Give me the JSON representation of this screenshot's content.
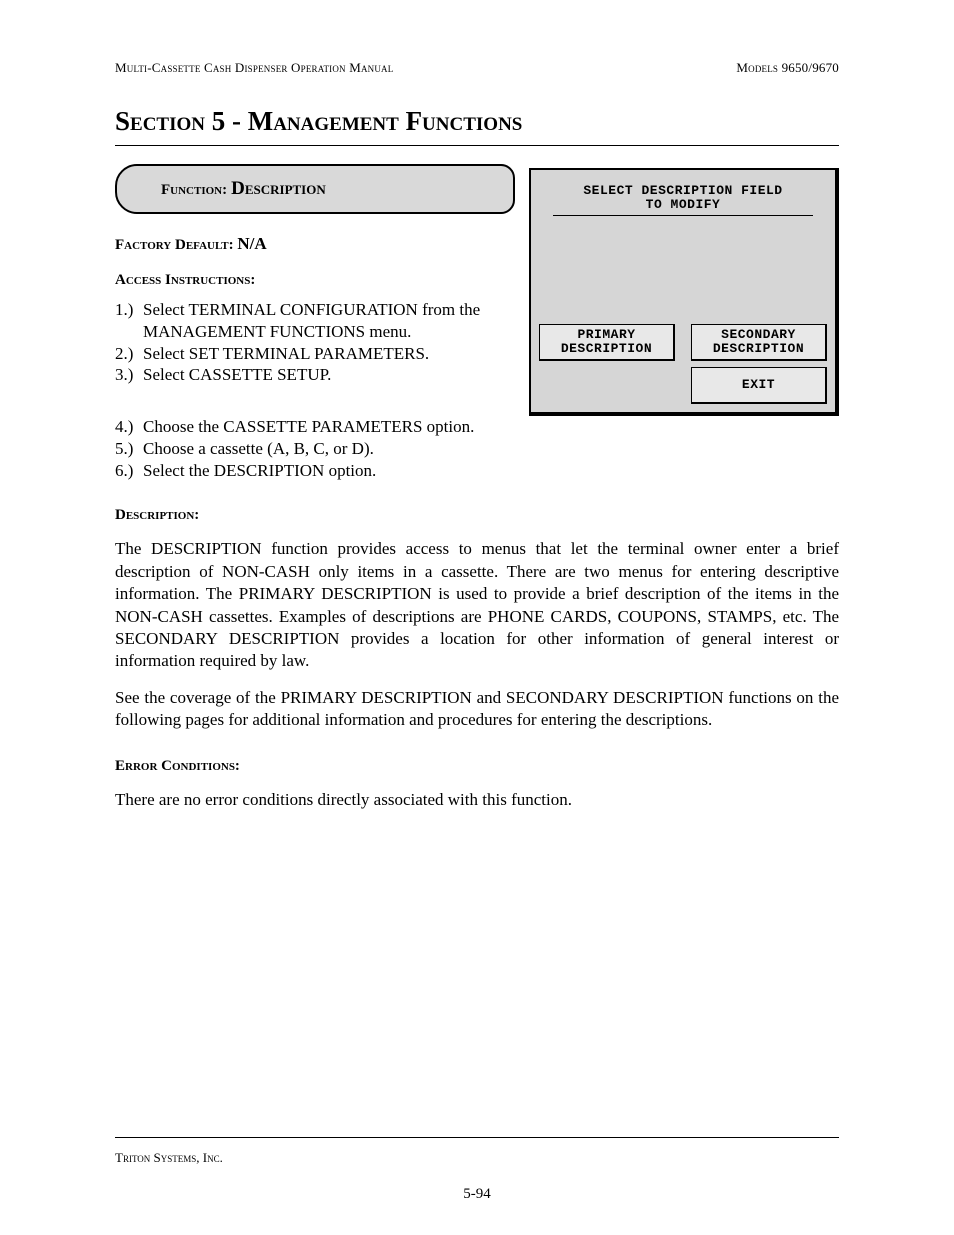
{
  "header": {
    "left": "Multi-Cassette Cash Dispenser Operation Manual",
    "right": "Models 9650/9670"
  },
  "section_title": "Section 5 - Management Functions",
  "function_box": {
    "label": "Function:",
    "value": "Description"
  },
  "factory_default": {
    "label": "Factory Default:",
    "value": "N/A"
  },
  "access_instructions": {
    "heading": "Access Instructions:",
    "steps": [
      {
        "num": "1.)",
        "text": "Select TERMINAL CONFIGURATION from the MANAGEMENT FUNCTIONS menu."
      },
      {
        "num": "2.)",
        "text": "Select SET TERMINAL PARAMETERS."
      },
      {
        "num": "3.)",
        "text": "Select CASSETTE SETUP."
      },
      {
        "num": "4.)",
        "text": "Choose the CASSETTE PARAMETERS option."
      },
      {
        "num": "5.)",
        "text": "Choose a cassette (A, B, C, or D)."
      },
      {
        "num": "6.)",
        "text": "Select the DESCRIPTION option."
      }
    ]
  },
  "screenshot": {
    "title_line1": "SELECT DESCRIPTION FIELD",
    "title_line2": "TO MODIFY",
    "buttons": {
      "left": "PRIMARY DESCRIPTION",
      "right_top": "SECONDARY DESCRIPTION",
      "right_bottom": "EXIT"
    }
  },
  "description": {
    "heading": "Description:",
    "para1": "The DESCRIPTION function provides access to menus that let the terminal owner enter a brief description of NON-CASH only items in a cassette.  There are two menus for entering descriptive information.  The PRIMARY DESCRIPTION is used to provide a brief description of the items in the NON-CASH cassettes.  Examples of descriptions are PHONE CARDS, COUPONS, STAMPS, etc.  The SECONDARY DESCRIPTION provides a location for other information of general interest or information required by law.",
    "para2": "See the coverage of the PRIMARY DESCRIPTION and SECONDARY DESCRIPTION functions on the following pages for additional information and procedures for entering the descriptions."
  },
  "error_conditions": {
    "heading": "Error Conditions:",
    "text": "There are no error conditions directly associated with this function."
  },
  "footer": {
    "company": "Triton Systems, Inc.",
    "page": "5-94"
  }
}
